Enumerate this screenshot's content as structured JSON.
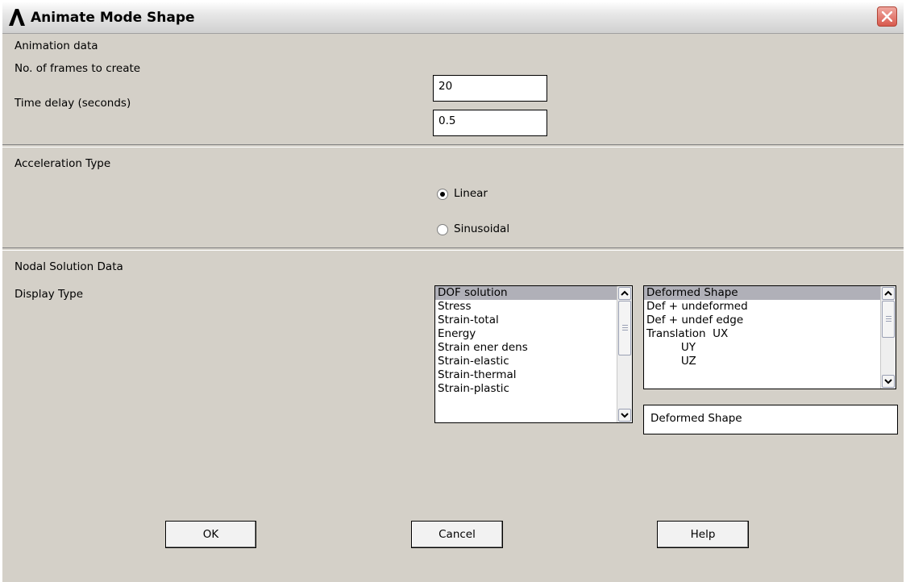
{
  "window": {
    "title": "Animate Mode Shape"
  },
  "animation": {
    "section_label": "Animation data",
    "frames_label": "No. of frames to create",
    "frames_value": "20",
    "delay_label": "Time delay (seconds)",
    "delay_value": "0.5"
  },
  "acceleration": {
    "section_label": "Acceleration Type",
    "options": [
      {
        "label": "Linear",
        "selected": true
      },
      {
        "label": "Sinusoidal",
        "selected": false
      }
    ]
  },
  "nodal": {
    "section_label": "Nodal Solution Data",
    "display_label": "Display Type",
    "left_list": [
      "DOF solution",
      "Stress",
      "Strain-total",
      "Energy",
      "Strain ener dens",
      "Strain-elastic",
      "Strain-thermal",
      "Strain-plastic"
    ],
    "right_list": [
      "Deformed Shape",
      "Def + undeformed",
      "Def + undef edge",
      "Translation  UX",
      "          UY",
      "          UZ"
    ],
    "right_value": "Deformed Shape"
  },
  "buttons": {
    "ok": "OK",
    "cancel": "Cancel",
    "help": "Help"
  }
}
